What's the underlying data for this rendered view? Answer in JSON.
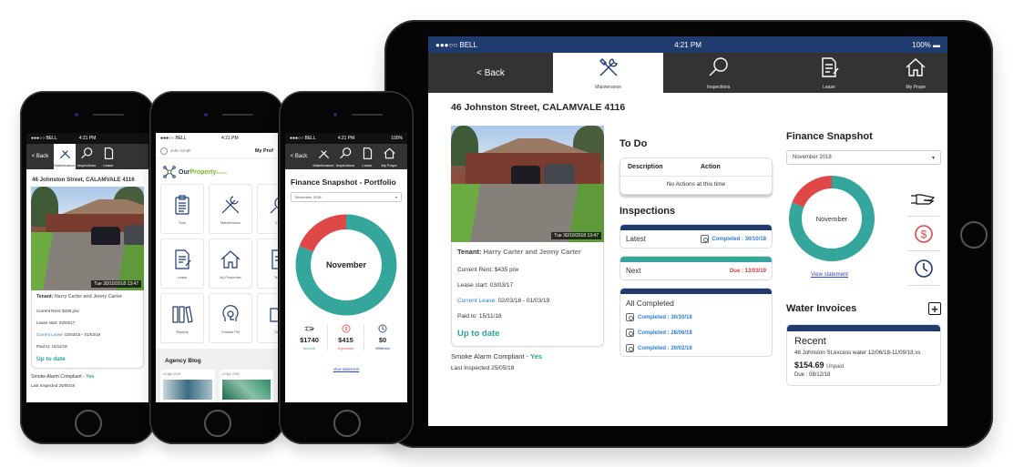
{
  "status_bar": {
    "carrier": "●●●○○ BELL",
    "time": "4:21 PM",
    "battery": "100%"
  },
  "nav": {
    "back_label": "< Back",
    "tabs": [
      {
        "label": "Maintenance",
        "icon": "wrench-screwdriver-icon",
        "active": true
      },
      {
        "label": "Inspections",
        "icon": "magnifier-icon",
        "active": false
      },
      {
        "label": "Lease",
        "icon": "document-pen-icon",
        "active": false
      },
      {
        "label": "My Prope",
        "icon": "house-icon",
        "active": false
      }
    ]
  },
  "property": {
    "address": "46 Johnston Street, CALAMVALE 4116",
    "photo_timestamp": "Tue 30/10/2018 13:47",
    "tenant_label": "Tenant:",
    "tenant_names": "Harry Carter and Jenny Carter",
    "current_rent": "Current Rent: $435 p/w",
    "lease_start": "Lease start: 03/03/17",
    "current_lease_label": "Current Lease:",
    "current_lease_value": "02/03/18 - 01/03/19",
    "paid_to": "Paid to: 15/11/18",
    "payment_status": "Up to date",
    "smoke_alarm_label": "Smoke Alarm Compliant - ",
    "smoke_alarm_value": "Yes",
    "last_inspected": "Last Inspected 25/05/18"
  },
  "todo": {
    "title": "To Do",
    "columns": [
      "Description",
      "Action"
    ],
    "empty_message": "No Actions at this time"
  },
  "inspections": {
    "title": "Inspections",
    "latest_label": "Latest",
    "latest_value": "Completed : 30/10/18",
    "next_label": "Next",
    "next_value": "Due : 12/03/19",
    "all_completed_label": "All Completed",
    "completed": [
      "Completed : 30/10/18",
      "Completed : 28/06/18",
      "Completed : 20/02/18"
    ]
  },
  "finance": {
    "title": "Finance Snapshot",
    "portfolio_title": "Finance Snapshot - Portfolio",
    "period": "November 2018",
    "donut_label": "November",
    "view_statement": "View statement",
    "income": {
      "value": "$1740",
      "label": "Income",
      "color": "#35a69c"
    },
    "expenses": {
      "value": "$415",
      "label": "Expenses",
      "color": "#e04848"
    },
    "withheld": {
      "value": "$0",
      "label": "Withheld",
      "color": "#1f3b6f"
    },
    "expense_fraction": 0.19
  },
  "water_invoices": {
    "title": "Water Invoices",
    "recent_label": "Recent",
    "description": "46 Johnston St,excess water 12/06/18-11/09/18,vs",
    "amount": "$154.69",
    "status": "Unpaid",
    "due": "Due : 08/12/18"
  },
  "home_menu": {
    "user_name": "John Smith",
    "page_title": "My Prof",
    "brand_our": "Our",
    "brand_property": "Property",
    "brand_suffix": "com.au",
    "tiles": [
      {
        "label": "Todo",
        "icon": "clipboard-icon"
      },
      {
        "label": "Maintenance",
        "icon": "wrench-screwdriver-icon"
      },
      {
        "label": "Insp",
        "icon": "magnifier-icon"
      },
      {
        "label": "Lease",
        "icon": "document-pen-icon"
      },
      {
        "label": "My Properties",
        "icon": "house-icon"
      },
      {
        "label": "Tenan",
        "icon": "document-icon"
      },
      {
        "label": "Reports",
        "icon": "binders-icon"
      },
      {
        "label": "Contact PM",
        "icon": "headset-icon"
      },
      {
        "label": "Sales",
        "icon": "folder-icon"
      }
    ],
    "blog_title": "Agency Blog",
    "blog_dates": [
      "24 Apr 2018",
      "24 Apr 2018"
    ]
  },
  "colors": {
    "navy": "#1f3b6f",
    "teal": "#35a69c",
    "red": "#e04848",
    "link": "#2e7fd6",
    "nav_dark": "#333333"
  }
}
